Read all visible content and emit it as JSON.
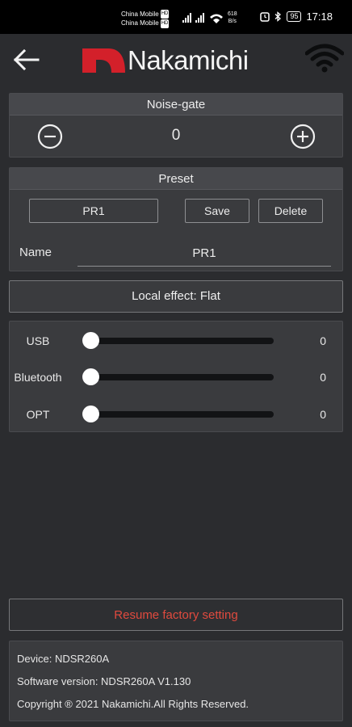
{
  "status_bar": {
    "carrier1": "China Mobile",
    "carrier2": "China Mobile",
    "carrier_tag": "HD",
    "speed_value": "618",
    "speed_unit": "B/s",
    "battery": "95",
    "time": "17:18"
  },
  "header": {
    "logo_text": "Nakamichi",
    "logo_color": "#d3202a",
    "icons": [
      "back-arrow-icon",
      "wifi-icon"
    ]
  },
  "noise_gate": {
    "title": "Noise-gate",
    "value": "0"
  },
  "preset": {
    "title": "Preset",
    "selected": "PR1",
    "save_label": "Save",
    "delete_label": "Delete",
    "name_label": "Name",
    "name_value": "PR1"
  },
  "local_effect": {
    "label": "Local effect: Flat"
  },
  "sources": [
    {
      "label": "USB",
      "value": "0",
      "level": 0
    },
    {
      "label": "Bluetooth",
      "value": "0",
      "level": 0
    },
    {
      "label": "OPT",
      "value": "0",
      "level": 0
    }
  ],
  "factory": {
    "label": "Resume factory setting",
    "color": "#e04a3e"
  },
  "info": {
    "device": "Device: NDSR260A",
    "software": "Software version: NDSR260A V1.130",
    "copyright": "Copyright ® 2021 Nakamichi.All Rights Reserved."
  }
}
